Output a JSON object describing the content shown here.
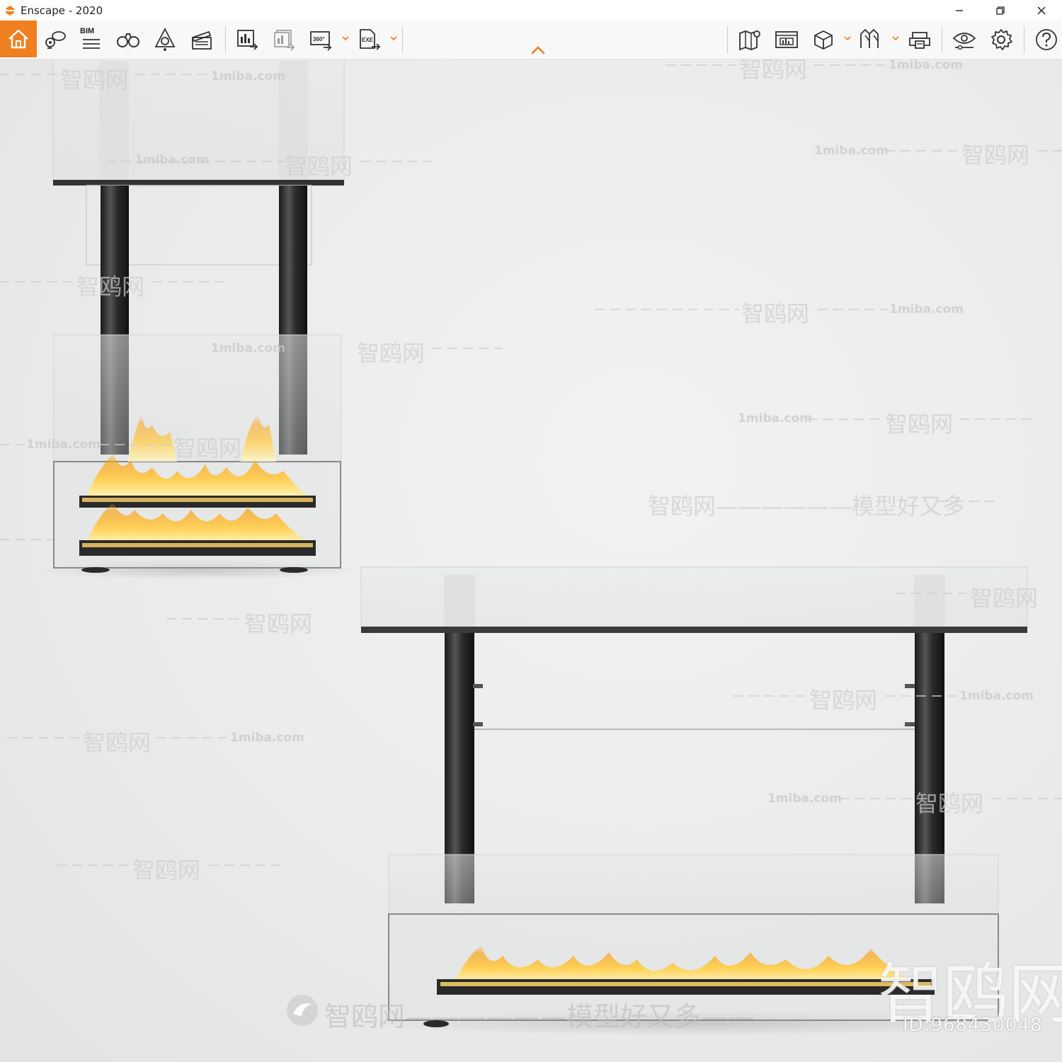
{
  "window": {
    "title": "Enscape - 2020",
    "controls": {
      "minimize": "minimize-icon",
      "restore": "restore-icon",
      "close": "close-icon"
    }
  },
  "toolbar": {
    "left_tools": [
      {
        "icon": "home-icon",
        "active": true
      },
      {
        "icon": "asset-library-icon"
      },
      {
        "icon": "bim-icon",
        "label": "BIM"
      },
      {
        "icon": "binoculars-icon"
      },
      {
        "icon": "visual-settings-icon"
      },
      {
        "icon": "clapperboard-icon"
      },
      {
        "icon": "render-image-icon"
      },
      {
        "icon": "batch-render-icon"
      },
      {
        "icon": "panorama-360-icon",
        "label": "360°"
      },
      {
        "icon": "export-exe-icon",
        "label": "EXE"
      }
    ],
    "right_tools": [
      {
        "icon": "map-pin-icon"
      },
      {
        "icon": "video-editor-icon"
      },
      {
        "icon": "cube-view-icon"
      },
      {
        "icon": "multi-views-icon"
      },
      {
        "icon": "capture-icon"
      },
      {
        "icon": "eye-settings-icon"
      },
      {
        "icon": "gear-icon"
      },
      {
        "icon": "help-icon"
      }
    ],
    "accent_color": "#f07f1f",
    "collapse_icon": "chevron-up-icon"
  },
  "viewport": {
    "watermarks": {
      "domain": "1miba.com",
      "brand_cn": "智鸥网",
      "slogan_cn": "智鸥网——————模型好又多",
      "slogan_cn_bottom": "智鸥网——————模型好又多——",
      "brand_cn_large": "智鸥网",
      "id_text": "ID:968430048"
    }
  }
}
